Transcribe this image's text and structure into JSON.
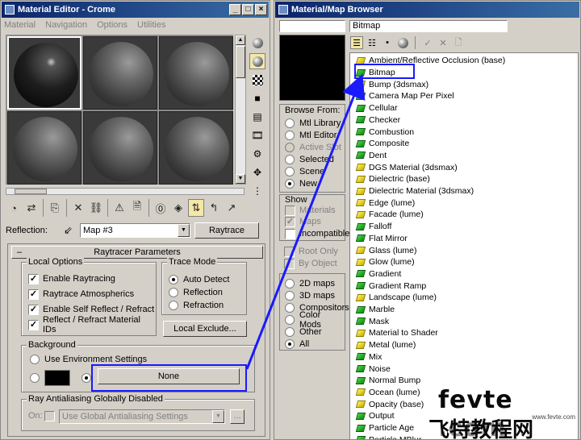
{
  "editor": {
    "title": "Material Editor - Crome",
    "menu": [
      "Material",
      "Navigation",
      "Options",
      "Utilities"
    ],
    "reflection_label": "Reflection:",
    "map_name": "Map #3",
    "map_type_button": "Raytrace",
    "rollout_title": "Raytracer Parameters",
    "local_options": {
      "title": "Local Options",
      "items": [
        {
          "label": "Enable Raytracing",
          "checked": true
        },
        {
          "label": "Raytrace Atmospherics",
          "checked": true
        },
        {
          "label": "Enable Self Reflect / Refract",
          "checked": true
        },
        {
          "label": "Reflect / Refract Material IDs",
          "checked": true
        }
      ]
    },
    "trace_mode": {
      "title": "Trace Mode",
      "options": [
        "Auto Detect",
        "Reflection",
        "Refraction"
      ],
      "selected": "Auto Detect"
    },
    "local_exclude_button": "Local Exclude...",
    "background": {
      "title": "Background",
      "env_option": "Use Environment Settings",
      "map_button": "None"
    },
    "antialias": {
      "title": "Ray Antialiasing Globally Disabled",
      "on_label": "On:",
      "select_value": "Use Global Antialiasing Settings",
      "browse_button": "..."
    }
  },
  "browser": {
    "title": "Material/Map Browser",
    "name_field": "",
    "type_field": "Bitmap",
    "browse_from": {
      "title": "Browse From:",
      "options": [
        "Mtl Library",
        "Mtl Editor",
        "Active Slot",
        "Selected",
        "Scene",
        "New"
      ],
      "selected": "New",
      "disabled": [
        "Active Slot"
      ]
    },
    "show": {
      "title": "Show",
      "items": [
        {
          "label": "Materials",
          "checked": false,
          "disabled": true
        },
        {
          "label": "Maps",
          "checked": true,
          "disabled": true
        },
        {
          "label": "Incompatible",
          "checked": false,
          "disabled": false
        }
      ]
    },
    "root_only": "Root Only",
    "by_object": "By Object",
    "map_filter": {
      "options": [
        "2D maps",
        "3D maps",
        "Compositors",
        "Color Mods",
        "Other",
        "All"
      ],
      "selected": "All"
    },
    "items": [
      {
        "label": "Ambient/Reflective Occlusion (base)",
        "icon": "yellow-map-icon"
      },
      {
        "label": "Bitmap",
        "icon": "green-map-icon"
      },
      {
        "label": "Bump (3dsmax)",
        "icon": "yellow-map-icon"
      },
      {
        "label": "Camera Map Per Pixel",
        "icon": "green-map-icon"
      },
      {
        "label": "Cellular",
        "icon": "green-map-icon"
      },
      {
        "label": "Checker",
        "icon": "green-map-icon"
      },
      {
        "label": "Combustion",
        "icon": "green-map-icon"
      },
      {
        "label": "Composite",
        "icon": "green-map-icon"
      },
      {
        "label": "Dent",
        "icon": "green-map-icon"
      },
      {
        "label": "DGS Material (3dsmax)",
        "icon": "yellow-map-icon"
      },
      {
        "label": "Dielectric (base)",
        "icon": "yellow-map-icon"
      },
      {
        "label": "Dielectric Material (3dsmax)",
        "icon": "yellow-map-icon"
      },
      {
        "label": "Edge (lume)",
        "icon": "yellow-map-icon"
      },
      {
        "label": "Facade (lume)",
        "icon": "yellow-map-icon"
      },
      {
        "label": "Falloff",
        "icon": "green-map-icon"
      },
      {
        "label": "Flat Mirror",
        "icon": "green-map-icon"
      },
      {
        "label": "Glass (lume)",
        "icon": "yellow-map-icon"
      },
      {
        "label": "Glow (lume)",
        "icon": "yellow-map-icon"
      },
      {
        "label": "Gradient",
        "icon": "green-map-icon"
      },
      {
        "label": "Gradient Ramp",
        "icon": "green-map-icon"
      },
      {
        "label": "Landscape (lume)",
        "icon": "yellow-map-icon"
      },
      {
        "label": "Marble",
        "icon": "green-map-icon"
      },
      {
        "label": "Mask",
        "icon": "green-map-icon"
      },
      {
        "label": "Material to Shader",
        "icon": "yellow-map-icon"
      },
      {
        "label": "Metal (lume)",
        "icon": "yellow-map-icon"
      },
      {
        "label": "Mix",
        "icon": "green-map-icon"
      },
      {
        "label": "Noise",
        "icon": "green-map-icon"
      },
      {
        "label": "Normal Bump",
        "icon": "green-map-icon"
      },
      {
        "label": "Ocean (lume)",
        "icon": "yellow-map-icon"
      },
      {
        "label": "Opacity (base)",
        "icon": "yellow-map-icon"
      },
      {
        "label": "Output",
        "icon": "green-map-icon"
      },
      {
        "label": "Particle Age",
        "icon": "green-map-icon"
      },
      {
        "label": "Particle MBlur",
        "icon": "green-map-icon"
      }
    ]
  },
  "watermark": {
    "line1": "fevte .com",
    "line2": "飞特教程网",
    "line3": "www.fevte.com"
  },
  "colors": {
    "title_bar": "#0a246a",
    "highlight_box": "#1a1aff",
    "panel": "#d4d0c8"
  }
}
